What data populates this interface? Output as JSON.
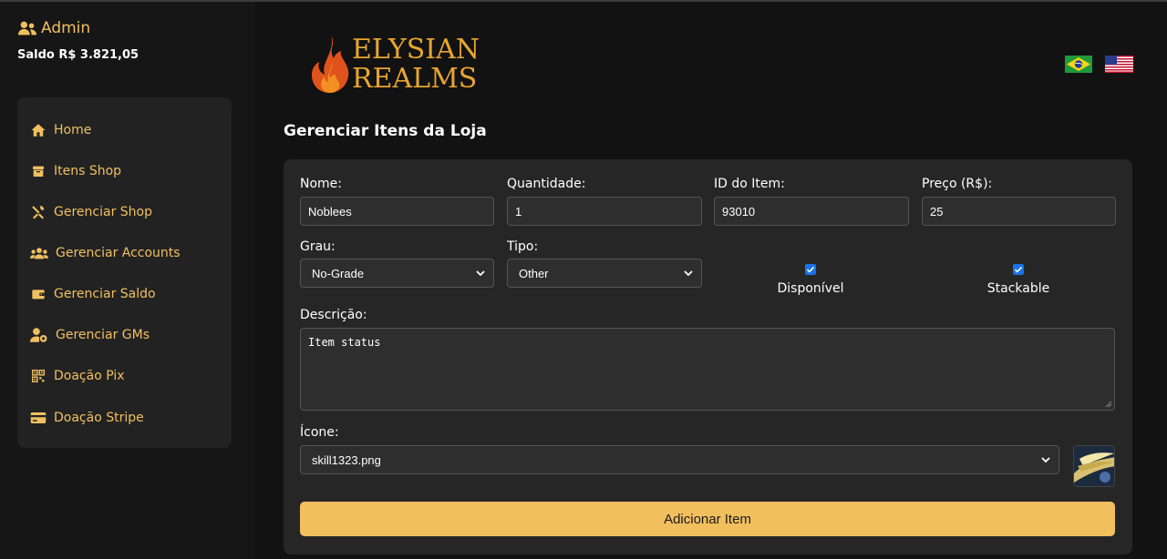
{
  "user": {
    "name": "Admin",
    "saldo": "Saldo R$ 3.821,05"
  },
  "nav": {
    "items": [
      {
        "label": "Home",
        "icon": "home-icon"
      },
      {
        "label": "Itens Shop",
        "icon": "box-icon"
      },
      {
        "label": "Gerenciar Shop",
        "icon": "tools-icon"
      },
      {
        "label": "Gerenciar Accounts",
        "icon": "users-icon"
      },
      {
        "label": "Gerenciar Saldo",
        "icon": "wallet-icon"
      },
      {
        "label": "Gerenciar GMs",
        "icon": "user-gear-icon"
      },
      {
        "label": "Doação Pix",
        "icon": "qrcode-icon"
      },
      {
        "label": "Doação Stripe",
        "icon": "credit-card-icon"
      }
    ]
  },
  "logo": {
    "line1": "ELYSIAN",
    "line2": "REALMS"
  },
  "page": {
    "title": "Gerenciar Itens da Loja"
  },
  "form": {
    "nome_label": "Nome:",
    "nome_value": "Noblees",
    "quantidade_label": "Quantidade:",
    "quantidade_value": "1",
    "id_label": "ID do Item:",
    "id_value": "93010",
    "preco_label": "Preço (R$):",
    "preco_value": "25",
    "grau_label": "Grau:",
    "grau_value": "No-Grade",
    "tipo_label": "Tipo:",
    "tipo_value": "Other",
    "disponivel_label": "Disponível",
    "disponivel_checked": true,
    "stackable_label": "Stackable",
    "stackable_checked": true,
    "descricao_label": "Descrição:",
    "descricao_value": "Item status",
    "icone_label": "Ícone:",
    "icone_value": "skill1323.png",
    "submit_label": "Adicionar Item"
  },
  "colors": {
    "accent": "#f0c060",
    "button": "#f2bf5e",
    "checkbox": "#1a73e8",
    "background": "#121212",
    "card": "#262626"
  }
}
